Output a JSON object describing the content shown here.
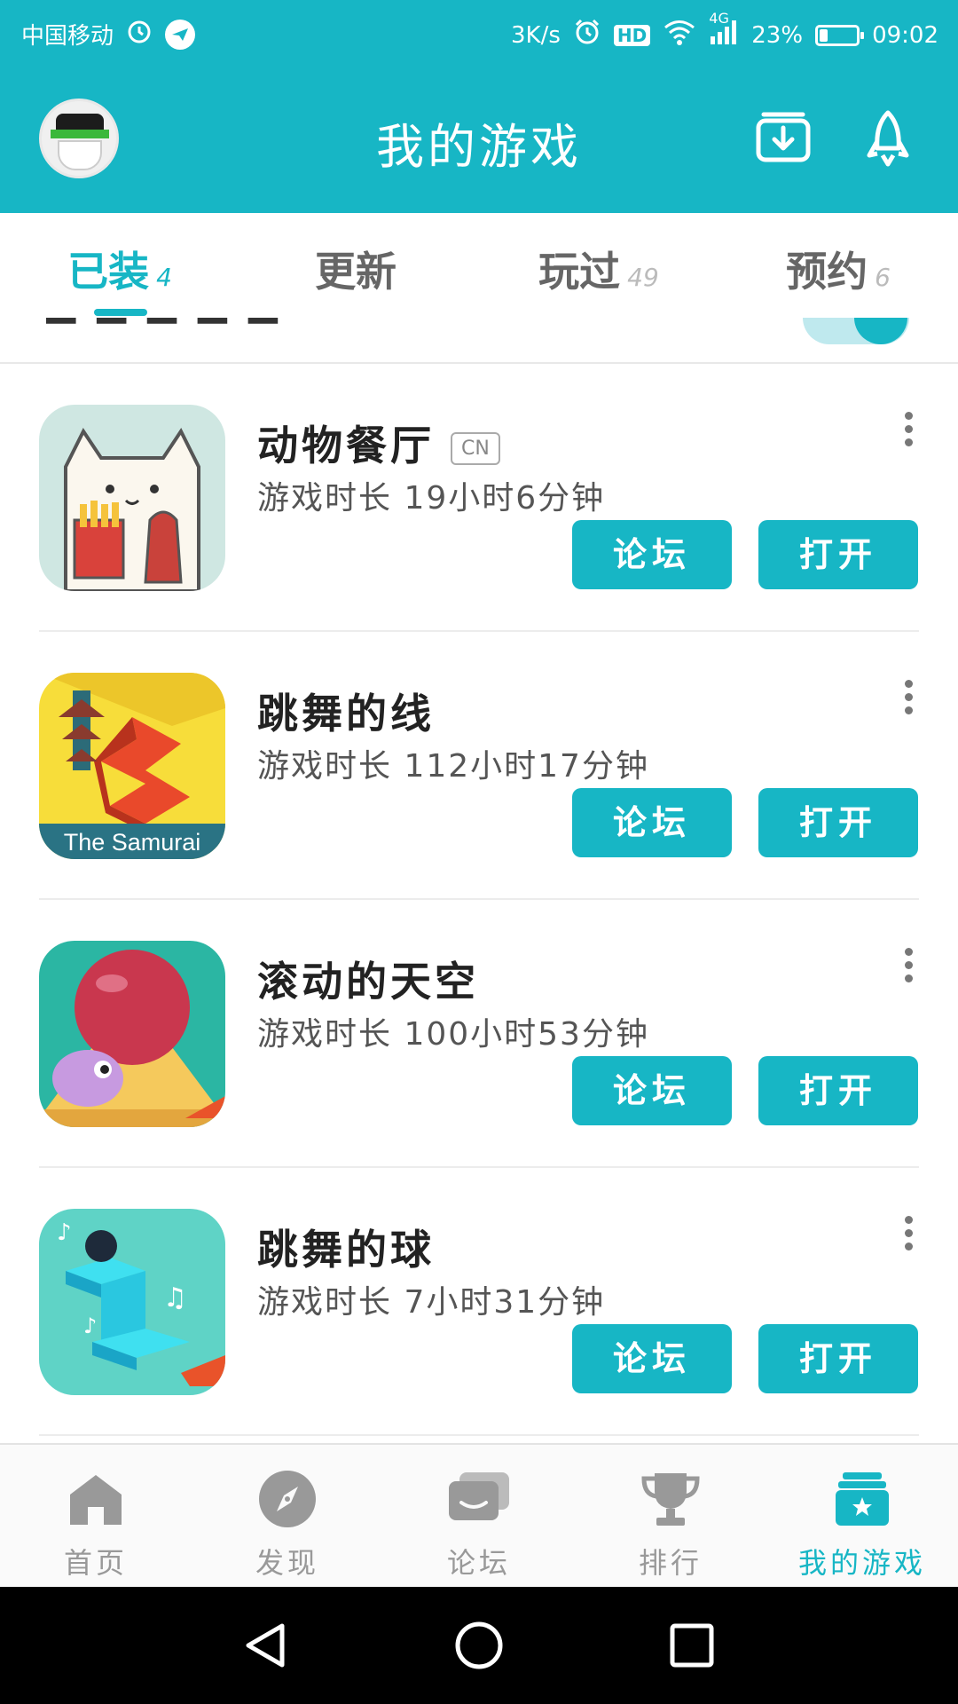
{
  "statusbar": {
    "carrier": "中国移动",
    "speed": "3K/s",
    "hd": "HD",
    "network": "4G",
    "battery": "23%",
    "battery_level": 0.23,
    "time": "09:02"
  },
  "header": {
    "title": "我的游戏"
  },
  "tabs": [
    {
      "label": "已装",
      "count": "4",
      "active": true
    },
    {
      "label": "更新",
      "count": ""
    },
    {
      "label": "玩过",
      "count": "49"
    },
    {
      "label": "预约",
      "count": "6"
    }
  ],
  "games": [
    {
      "name": "动物餐厅",
      "badge": "CN",
      "playtime": "游戏时长 19小时6分钟",
      "forum": "论坛",
      "open": "打开"
    },
    {
      "name": "跳舞的线",
      "badge": "",
      "playtime": "游戏时长 112小时17分钟",
      "forum": "论坛",
      "open": "打开",
      "icon_caption": "The Samurai"
    },
    {
      "name": "滚动的天空",
      "badge": "",
      "playtime": "游戏时长 100小时53分钟",
      "forum": "论坛",
      "open": "打开"
    },
    {
      "name": "跳舞的球",
      "badge": "",
      "playtime": "游戏时长 7小时31分钟",
      "forum": "论坛",
      "open": "打开"
    }
  ],
  "bottomnav": [
    {
      "label": "首页",
      "icon": "home-icon"
    },
    {
      "label": "发现",
      "icon": "compass-icon"
    },
    {
      "label": "论坛",
      "icon": "forum-icon"
    },
    {
      "label": "排行",
      "icon": "trophy-icon"
    },
    {
      "label": "我的游戏",
      "icon": "my-games-icon",
      "active": true
    }
  ],
  "colors": {
    "accent": "#17b6c5",
    "inactive": "#999999"
  }
}
